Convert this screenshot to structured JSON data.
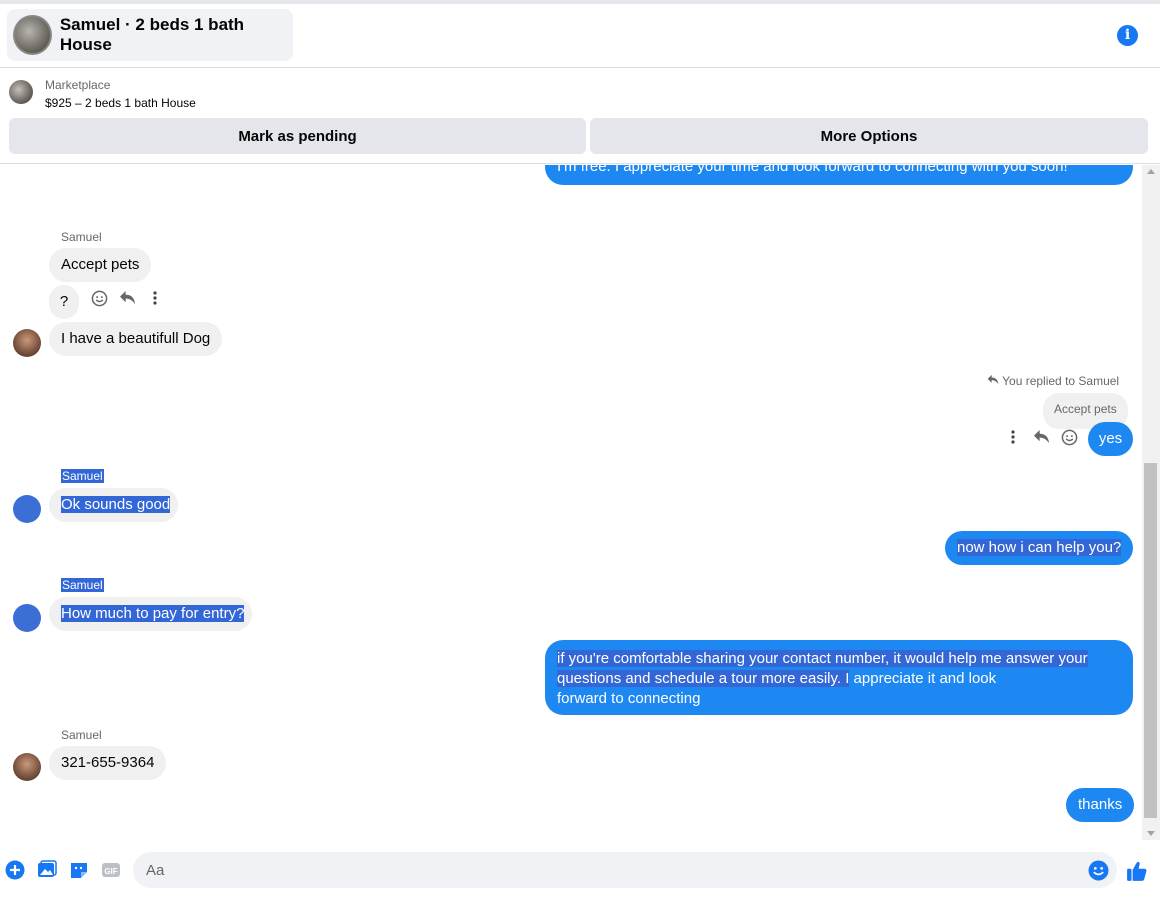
{
  "header": {
    "title": "Samuel · 2 beds 1 bath House",
    "info_icon": "i"
  },
  "listing": {
    "label": "Marketplace",
    "item": "$925 – 2 beds 1 bath House",
    "mark_pending": "Mark as pending",
    "more_options": "More Options"
  },
  "messages": {
    "top_cut": "I'm free. I appreciate your time and look forward to connecting with you soon!",
    "sender1": "Samuel",
    "accept_pets": "Accept pets",
    "question": "?",
    "dog": "I have a beautifull Dog",
    "replied_note": "You replied to Samuel",
    "quoted": "Accept pets",
    "yes": "yes",
    "sender2": "Samuel",
    "sounds_good": "Ok sounds good",
    "help": "now how i can help you?",
    "sender3": "Samuel",
    "entry": "How much to pay for entry?",
    "long_line1": "if you're comfortable sharing your contact number, it would help me answer your",
    "long_line2a": "questions and schedule a tour more easily. I",
    "long_line2b": " appreciate it and look",
    "long_line3": "forward to connecting",
    "sender4": "Samuel",
    "phone": "321-655-9364",
    "thanks": "thanks"
  },
  "composer": {
    "placeholder": "Aa"
  },
  "colors": {
    "accent": "#1877f2",
    "bubble_out": "#1e88f2",
    "bubble_in": "#f0f0f0",
    "selection": "#3367d6"
  }
}
